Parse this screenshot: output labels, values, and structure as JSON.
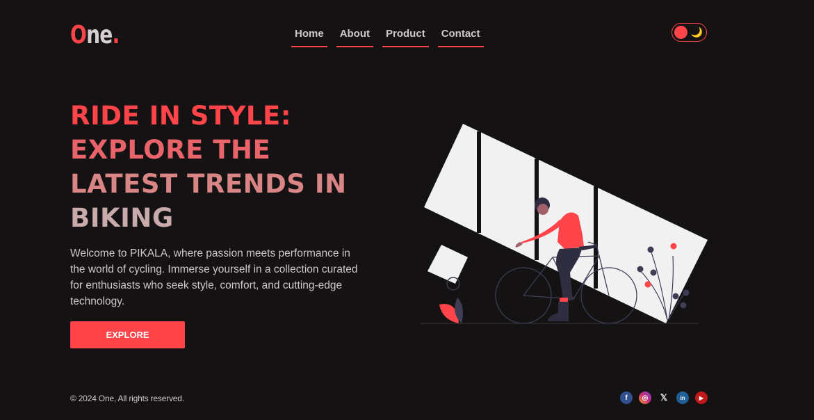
{
  "brand": {
    "logo_first": "O",
    "logo_rest": "ne",
    "logo_dot": "."
  },
  "nav": {
    "items": [
      {
        "label": "Home"
      },
      {
        "label": "About"
      },
      {
        "label": "Product"
      },
      {
        "label": "Contact"
      }
    ]
  },
  "theme_toggle": {
    "icon": "moon-icon",
    "state": "dark"
  },
  "hero": {
    "headline_lines": [
      "RIDE IN STYLE:",
      "EXPLORE THE",
      "LATEST TRENDS IN",
      "BIKING"
    ],
    "intro": "Welcome to PIKALA, where passion meets performance in the world of cycling. Immerse yourself in a collection curated for enthusiasts who seek style, comfort, and cutting-edge technology.",
    "cta_label": "EXPLORE"
  },
  "footer": {
    "copyright": "© 2024 One, All rights reserved.",
    "socials": [
      {
        "name": "facebook-icon",
        "glyph": "f"
      },
      {
        "name": "instagram-icon",
        "glyph": "◎"
      },
      {
        "name": "x-icon",
        "glyph": "𝕏"
      },
      {
        "name": "linkedin-icon",
        "glyph": "in"
      },
      {
        "name": "youtube-icon",
        "glyph": "▶"
      }
    ]
  },
  "colors": {
    "accent": "#ff4549",
    "background": "#141213",
    "text": "#cfc8c8",
    "toggle_moon": "#f2c33f"
  }
}
